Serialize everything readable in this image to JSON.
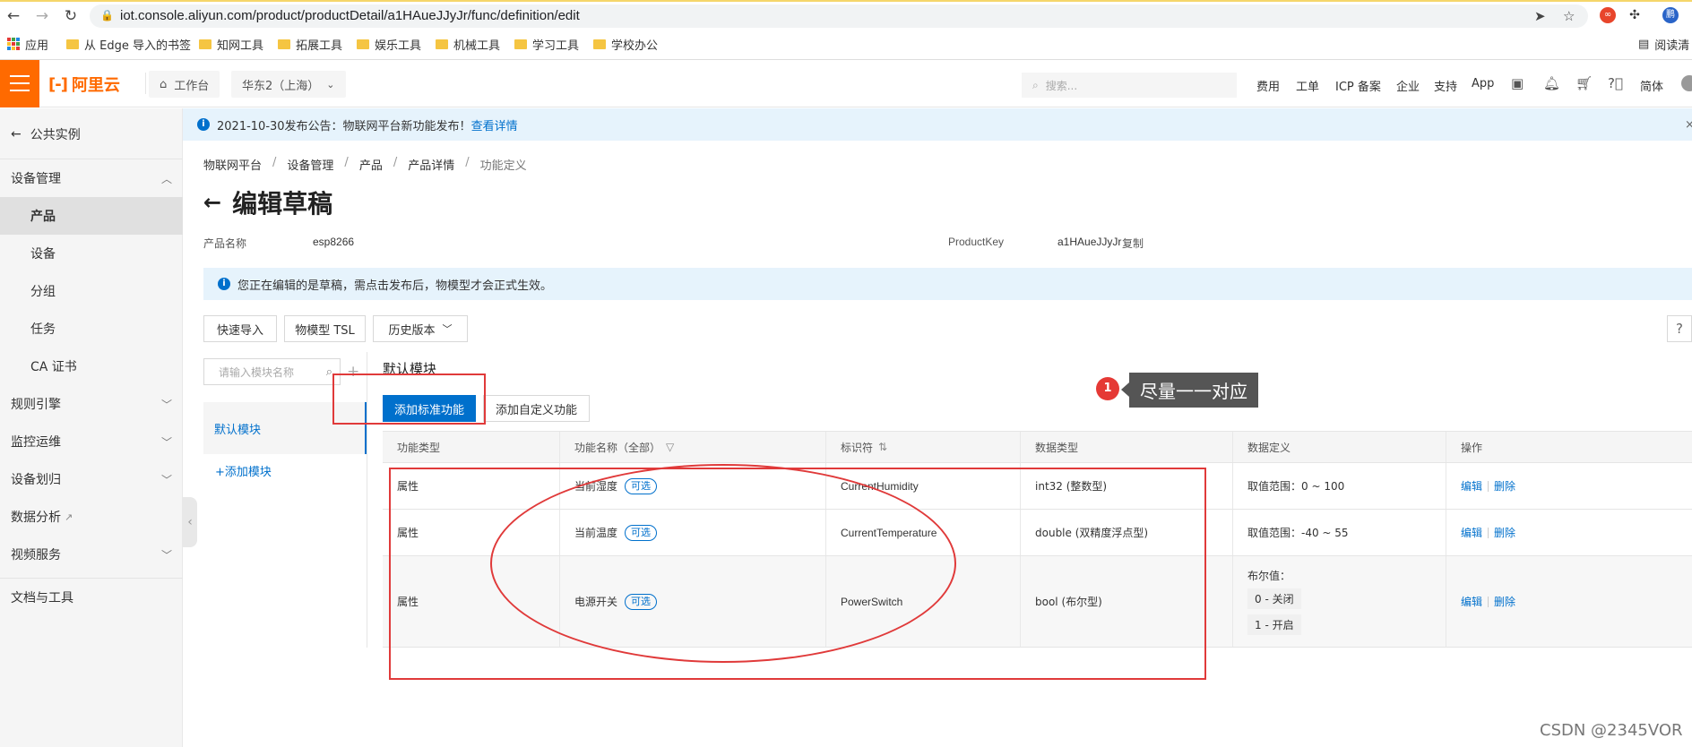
{
  "browser": {
    "url": "iot.console.aliyun.com/product/productDetail/a1HAueJJyJr/func/definition/edit",
    "bookmarks": [
      "应用",
      "从 Edge 导入的书签",
      "知网工具",
      "拓展工具",
      "娱乐工具",
      "机械工具",
      "学习工具",
      "学校办公"
    ],
    "reading_list": "阅读清"
  },
  "header": {
    "logo": "阿里云",
    "workbench": "工作台",
    "region": "华东2（上海）",
    "search_placeholder": "搜索...",
    "links": [
      "费用",
      "工单",
      "ICP 备案",
      "企业",
      "支持",
      "App"
    ],
    "lang": "简体"
  },
  "sidebar": {
    "back_label": "公共实例",
    "section": "设备管理",
    "sub_items": [
      "产品",
      "设备",
      "分组",
      "任务",
      "CA 证书"
    ],
    "groups": [
      "规则引擎",
      "监控运维",
      "设备划归",
      "数据分析",
      "视频服务",
      "文档与工具"
    ]
  },
  "notice": {
    "text": "2021-10-30发布公告：物联网平台新功能发布！",
    "link": "查看详情"
  },
  "breadcrumb": [
    "物联网平台",
    "设备管理",
    "产品",
    "产品详情",
    "功能定义"
  ],
  "page": {
    "title": "编辑草稿",
    "product_name_label": "产品名称",
    "product_name": "esp8266",
    "product_key_label": "ProductKey",
    "product_key": "a1HAueJJyJr",
    "copy": "复制",
    "draft_banner": "您正在编辑的是草稿，需点击发布后，物模型才会正式生效。"
  },
  "toolbar": {
    "quick_import": "快速导入",
    "tsl": "物模型 TSL",
    "history": "历史版本",
    "help": "?"
  },
  "modules": {
    "search_placeholder": "请输入模块名称",
    "plus": "+",
    "default_module": "默认模块",
    "add_module": "+添加模块",
    "title": "默认模块",
    "add_standard": "添加标准功能",
    "add_custom": "添加自定义功能"
  },
  "table": {
    "headers": [
      "功能类型",
      "功能名称（全部）",
      "标识符",
      "数据类型",
      "数据定义",
      "操作"
    ],
    "rows": [
      {
        "type": "属性",
        "name": "当前湿度",
        "tag": "可选",
        "identifier": "CurrentHumidity",
        "dtype": "int32 (整数型)",
        "def": "取值范围：0 ~ 100",
        "edit": "编辑",
        "delete": "删除"
      },
      {
        "type": "属性",
        "name": "当前温度",
        "tag": "可选",
        "identifier": "CurrentTemperature",
        "dtype": "double (双精度浮点型)",
        "def": "取值范围：-40 ~ 55",
        "edit": "编辑",
        "delete": "删除"
      },
      {
        "type": "属性",
        "name": "电源开关",
        "tag": "可选",
        "identifier": "PowerSwitch",
        "dtype": "bool (布尔型)",
        "def_title": "布尔值：",
        "def_values": [
          "0 - 关闭",
          "1 - 开启"
        ],
        "edit": "编辑",
        "delete": "删除"
      }
    ]
  },
  "annotation": {
    "number": "1",
    "text": "尽量一一对应"
  },
  "watermark": "CSDN @2345VOR",
  "colors": {
    "accent": "#0070cc",
    "brand": "#ff6a00",
    "annotation": "#e03a3a"
  }
}
